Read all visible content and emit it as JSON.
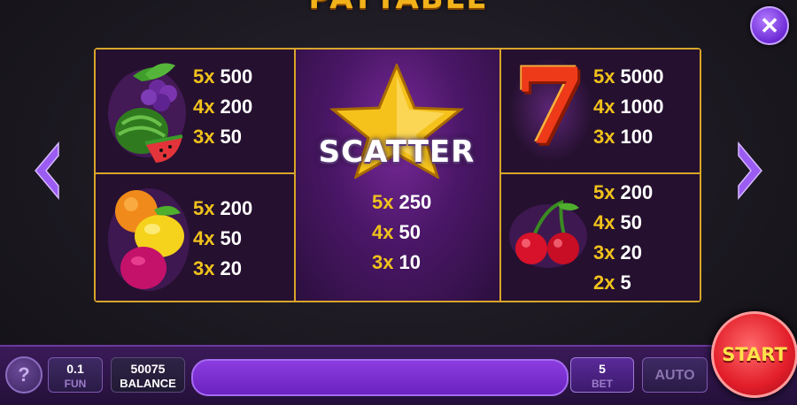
{
  "title": "PAYTABLE",
  "close_label": "✕",
  "symbols": {
    "mixed_fruit": {
      "pays": [
        {
          "count": "5x",
          "value": "500"
        },
        {
          "count": "4x",
          "value": "200"
        },
        {
          "count": "3x",
          "value": "50"
        }
      ]
    },
    "citrus_plum": {
      "pays": [
        {
          "count": "5x",
          "value": "200"
        },
        {
          "count": "4x",
          "value": "50"
        },
        {
          "count": "3x",
          "value": "20"
        }
      ]
    },
    "scatter": {
      "label": "SCATTER",
      "pays": [
        {
          "count": "5x",
          "value": "250"
        },
        {
          "count": "4x",
          "value": "50"
        },
        {
          "count": "3x",
          "value": "10"
        }
      ]
    },
    "seven": {
      "label": "7",
      "pays": [
        {
          "count": "5x",
          "value": "5000"
        },
        {
          "count": "4x",
          "value": "1000"
        },
        {
          "count": "3x",
          "value": "100"
        }
      ]
    },
    "cherry": {
      "pays": [
        {
          "count": "5x",
          "value": "200"
        },
        {
          "count": "4x",
          "value": "50"
        },
        {
          "count": "3x",
          "value": "20"
        },
        {
          "count": "2x",
          "value": "5"
        }
      ]
    }
  },
  "bottom": {
    "help_label": "?",
    "fun": {
      "value": "0.1",
      "label": "FUN"
    },
    "balance": {
      "value": "50075",
      "label": "BALANCE"
    },
    "bet": {
      "value": "5",
      "label": "BET"
    },
    "auto_label": "AUTO",
    "start_label": "START"
  },
  "colors": {
    "gold": "#d9a52a",
    "purple": "#6a22c0",
    "start_red": "#e21e2a"
  }
}
